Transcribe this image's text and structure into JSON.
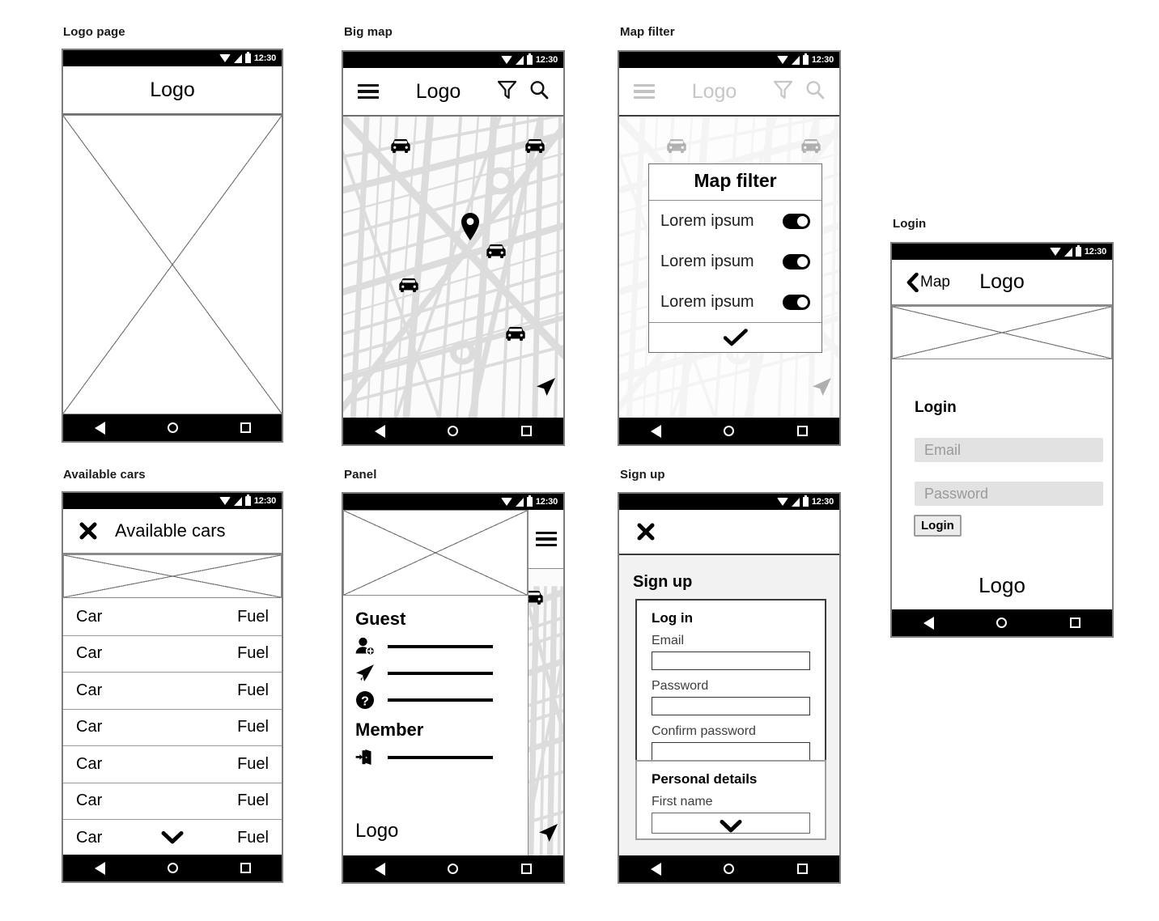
{
  "meta": {
    "status_time": "12:30",
    "colors": {
      "frame": "#7d7d7d",
      "bar_black": "#000000",
      "map_road": "#d9d9d9",
      "map_bg": "#fbfbfb",
      "pill_grey": "#e2e2e2",
      "panel_grey": "#f2f2f2"
    }
  },
  "screens": {
    "logo_page": {
      "caption": "Logo page",
      "appbar_title": "Logo",
      "placeholder": "image-placeholder"
    },
    "big_map": {
      "caption": "Big map",
      "appbar_title": "Logo",
      "icons": {
        "menu": "hamburger-icon",
        "filter": "funnel-icon",
        "search": "magnifier-icon",
        "location": "navigation-arrow-icon",
        "marker": "map-pin-icon",
        "car": "car-icon"
      },
      "car_markers": 5
    },
    "map_filter": {
      "caption": "Map filter",
      "appbar_title": "Logo",
      "dialog": {
        "title": "Map filter",
        "rows": [
          {
            "label": "Lorem ipsum",
            "enabled": true
          },
          {
            "label": "Lorem ipsum",
            "enabled": true
          },
          {
            "label": "Lorem ipsum",
            "enabled": true
          }
        ],
        "confirm_icon": "check-icon"
      }
    },
    "login": {
      "caption": "Login",
      "back_label": "Map",
      "appbar_title": "Logo",
      "section_title": "Login",
      "email_placeholder": "Email",
      "password_placeholder": "Password",
      "login_button": "Login",
      "footer_logo": "Logo"
    },
    "available_cars": {
      "caption": "Available cars",
      "appbar_title": "Available cars",
      "close_icon": "close-x-icon",
      "col_left": "Car",
      "col_right": "Fuel",
      "rows": [
        {
          "car": "Car",
          "fuel": "Fuel"
        },
        {
          "car": "Car",
          "fuel": "Fuel"
        },
        {
          "car": "Car",
          "fuel": "Fuel"
        },
        {
          "car": "Car",
          "fuel": "Fuel"
        },
        {
          "car": "Car",
          "fuel": "Fuel"
        },
        {
          "car": "Car",
          "fuel": "Fuel"
        },
        {
          "car": "Car",
          "fuel": "Fuel"
        }
      ],
      "expand_icon": "chevron-down-icon"
    },
    "panel": {
      "caption": "Panel",
      "menu_icon": "hamburger-icon",
      "guest_title": "Guest",
      "guest_items": [
        {
          "icon": "add-user-icon",
          "label": ""
        },
        {
          "icon": "paper-plane-icon",
          "label": ""
        },
        {
          "icon": "question-circle-icon",
          "label": ""
        }
      ],
      "member_title": "Member",
      "member_items": [
        {
          "icon": "logout-icon",
          "label": ""
        }
      ],
      "footer_logo": "Logo"
    },
    "sign_up": {
      "caption": "Sign up",
      "close_icon": "close-x-icon",
      "page_title": "Sign up",
      "login_card": {
        "title": "Log in",
        "fields": [
          {
            "label": "Email",
            "value": ""
          },
          {
            "label": "Password",
            "value": ""
          },
          {
            "label": "Confirm password",
            "value": ""
          }
        ]
      },
      "personal_card": {
        "title": "Personal details",
        "fields": [
          {
            "label": "First name",
            "value": ""
          }
        ],
        "expand_icon": "chevron-down-icon"
      }
    }
  }
}
